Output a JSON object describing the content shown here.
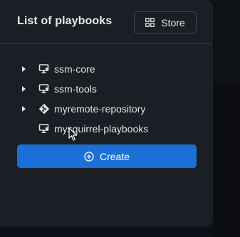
{
  "panel": {
    "title": "List of playbooks",
    "store_button": {
      "label": "Store",
      "icon": "grid-icon"
    }
  },
  "tree": {
    "items": [
      {
        "label": "ssm-core",
        "icon": "monitor-icon",
        "expandable": true
      },
      {
        "label": "ssm-tools",
        "icon": "monitor-icon",
        "expandable": true
      },
      {
        "label": "myremote-repository",
        "icon": "git-icon",
        "expandable": true
      },
      {
        "label": "mysquirrel-playbooks",
        "icon": "monitor-icon",
        "expandable": false
      }
    ]
  },
  "create_button": {
    "label": "Create",
    "icon": "plus-circle-icon"
  },
  "colors": {
    "accent": "#1d6fd8",
    "panel_bg": "#1b1e24",
    "text": "#dfe2e7"
  }
}
